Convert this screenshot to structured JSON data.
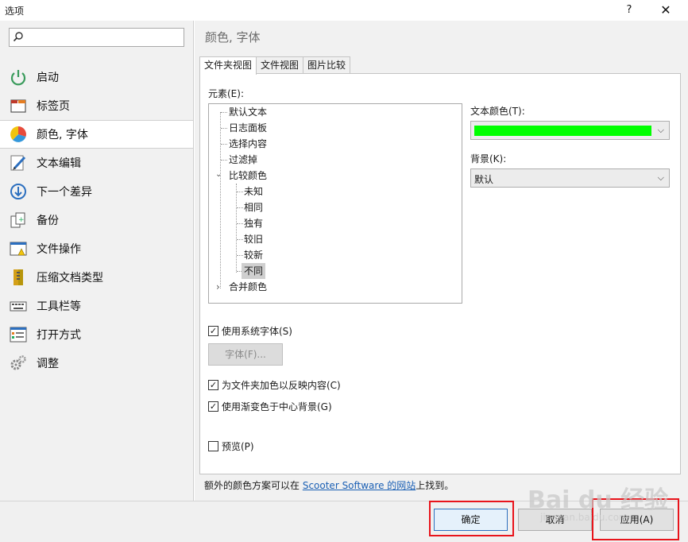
{
  "window": {
    "title": "选项",
    "help_label": "?",
    "close_label": "✕"
  },
  "sidebar": {
    "search_placeholder": "",
    "items": [
      {
        "label": "启动",
        "icon": "power-icon"
      },
      {
        "label": "标签页",
        "icon": "tab-icon"
      },
      {
        "label": "颜色, 字体",
        "icon": "pie-chart-icon",
        "selected": true
      },
      {
        "label": "文本编辑",
        "icon": "pencil-icon"
      },
      {
        "label": "下一个差异",
        "icon": "down-arrow-icon"
      },
      {
        "label": "备份",
        "icon": "backup-icon"
      },
      {
        "label": "文件操作",
        "icon": "file-warning-icon"
      },
      {
        "label": "压缩文档类型",
        "icon": "zipper-icon"
      },
      {
        "label": "工具栏等",
        "icon": "keyboard-icon"
      },
      {
        "label": "打开方式",
        "icon": "window-list-icon"
      },
      {
        "label": "调整",
        "icon": "gears-icon"
      }
    ]
  },
  "main": {
    "section_title": "颜色, 字体",
    "tabs": [
      {
        "label": "文件夹视图",
        "active": true
      },
      {
        "label": "文件视图"
      },
      {
        "label": "图片比较"
      }
    ],
    "elements_label": "元素(E):",
    "tree": [
      {
        "label": "默认文本"
      },
      {
        "label": "日志面板"
      },
      {
        "label": "选择内容"
      },
      {
        "label": "过滤掉"
      },
      {
        "label": "比较颜色",
        "expander": "⌄"
      },
      {
        "label": "未知"
      },
      {
        "label": "相同"
      },
      {
        "label": "独有"
      },
      {
        "label": "较旧"
      },
      {
        "label": "较新"
      },
      {
        "label": "不同",
        "selected": true
      },
      {
        "label": "合并颜色",
        "expander": "›"
      }
    ],
    "text_color_label": "文本颜色(T):",
    "text_color_value": "#00ff00",
    "background_label": "背景(K):",
    "background_value": "默认",
    "use_system_font_label": "使用系统字体(S)",
    "use_system_font_checked": true,
    "font_button_label": "字体(F)...",
    "colorize_folders_label": "为文件夹加色以反映内容(C)",
    "colorize_folders_checked": true,
    "gradient_label": "使用渐变色于中心背景(G)",
    "gradient_checked": true,
    "preview_label": "预览(P)",
    "preview_checked": false,
    "footer_prefix": "额外的颜色方案可以在 ",
    "footer_link": "Scooter Software 的网站",
    "footer_suffix": "上找到。"
  },
  "buttons": {
    "ok": "确定",
    "cancel": "取消",
    "apply": "应用(A)"
  },
  "watermark": {
    "logo": "Bai du 经验",
    "url": "jingyan.baidu.com"
  },
  "colors": {
    "highlight": "#e8141b",
    "link": "#1a5fb4"
  }
}
